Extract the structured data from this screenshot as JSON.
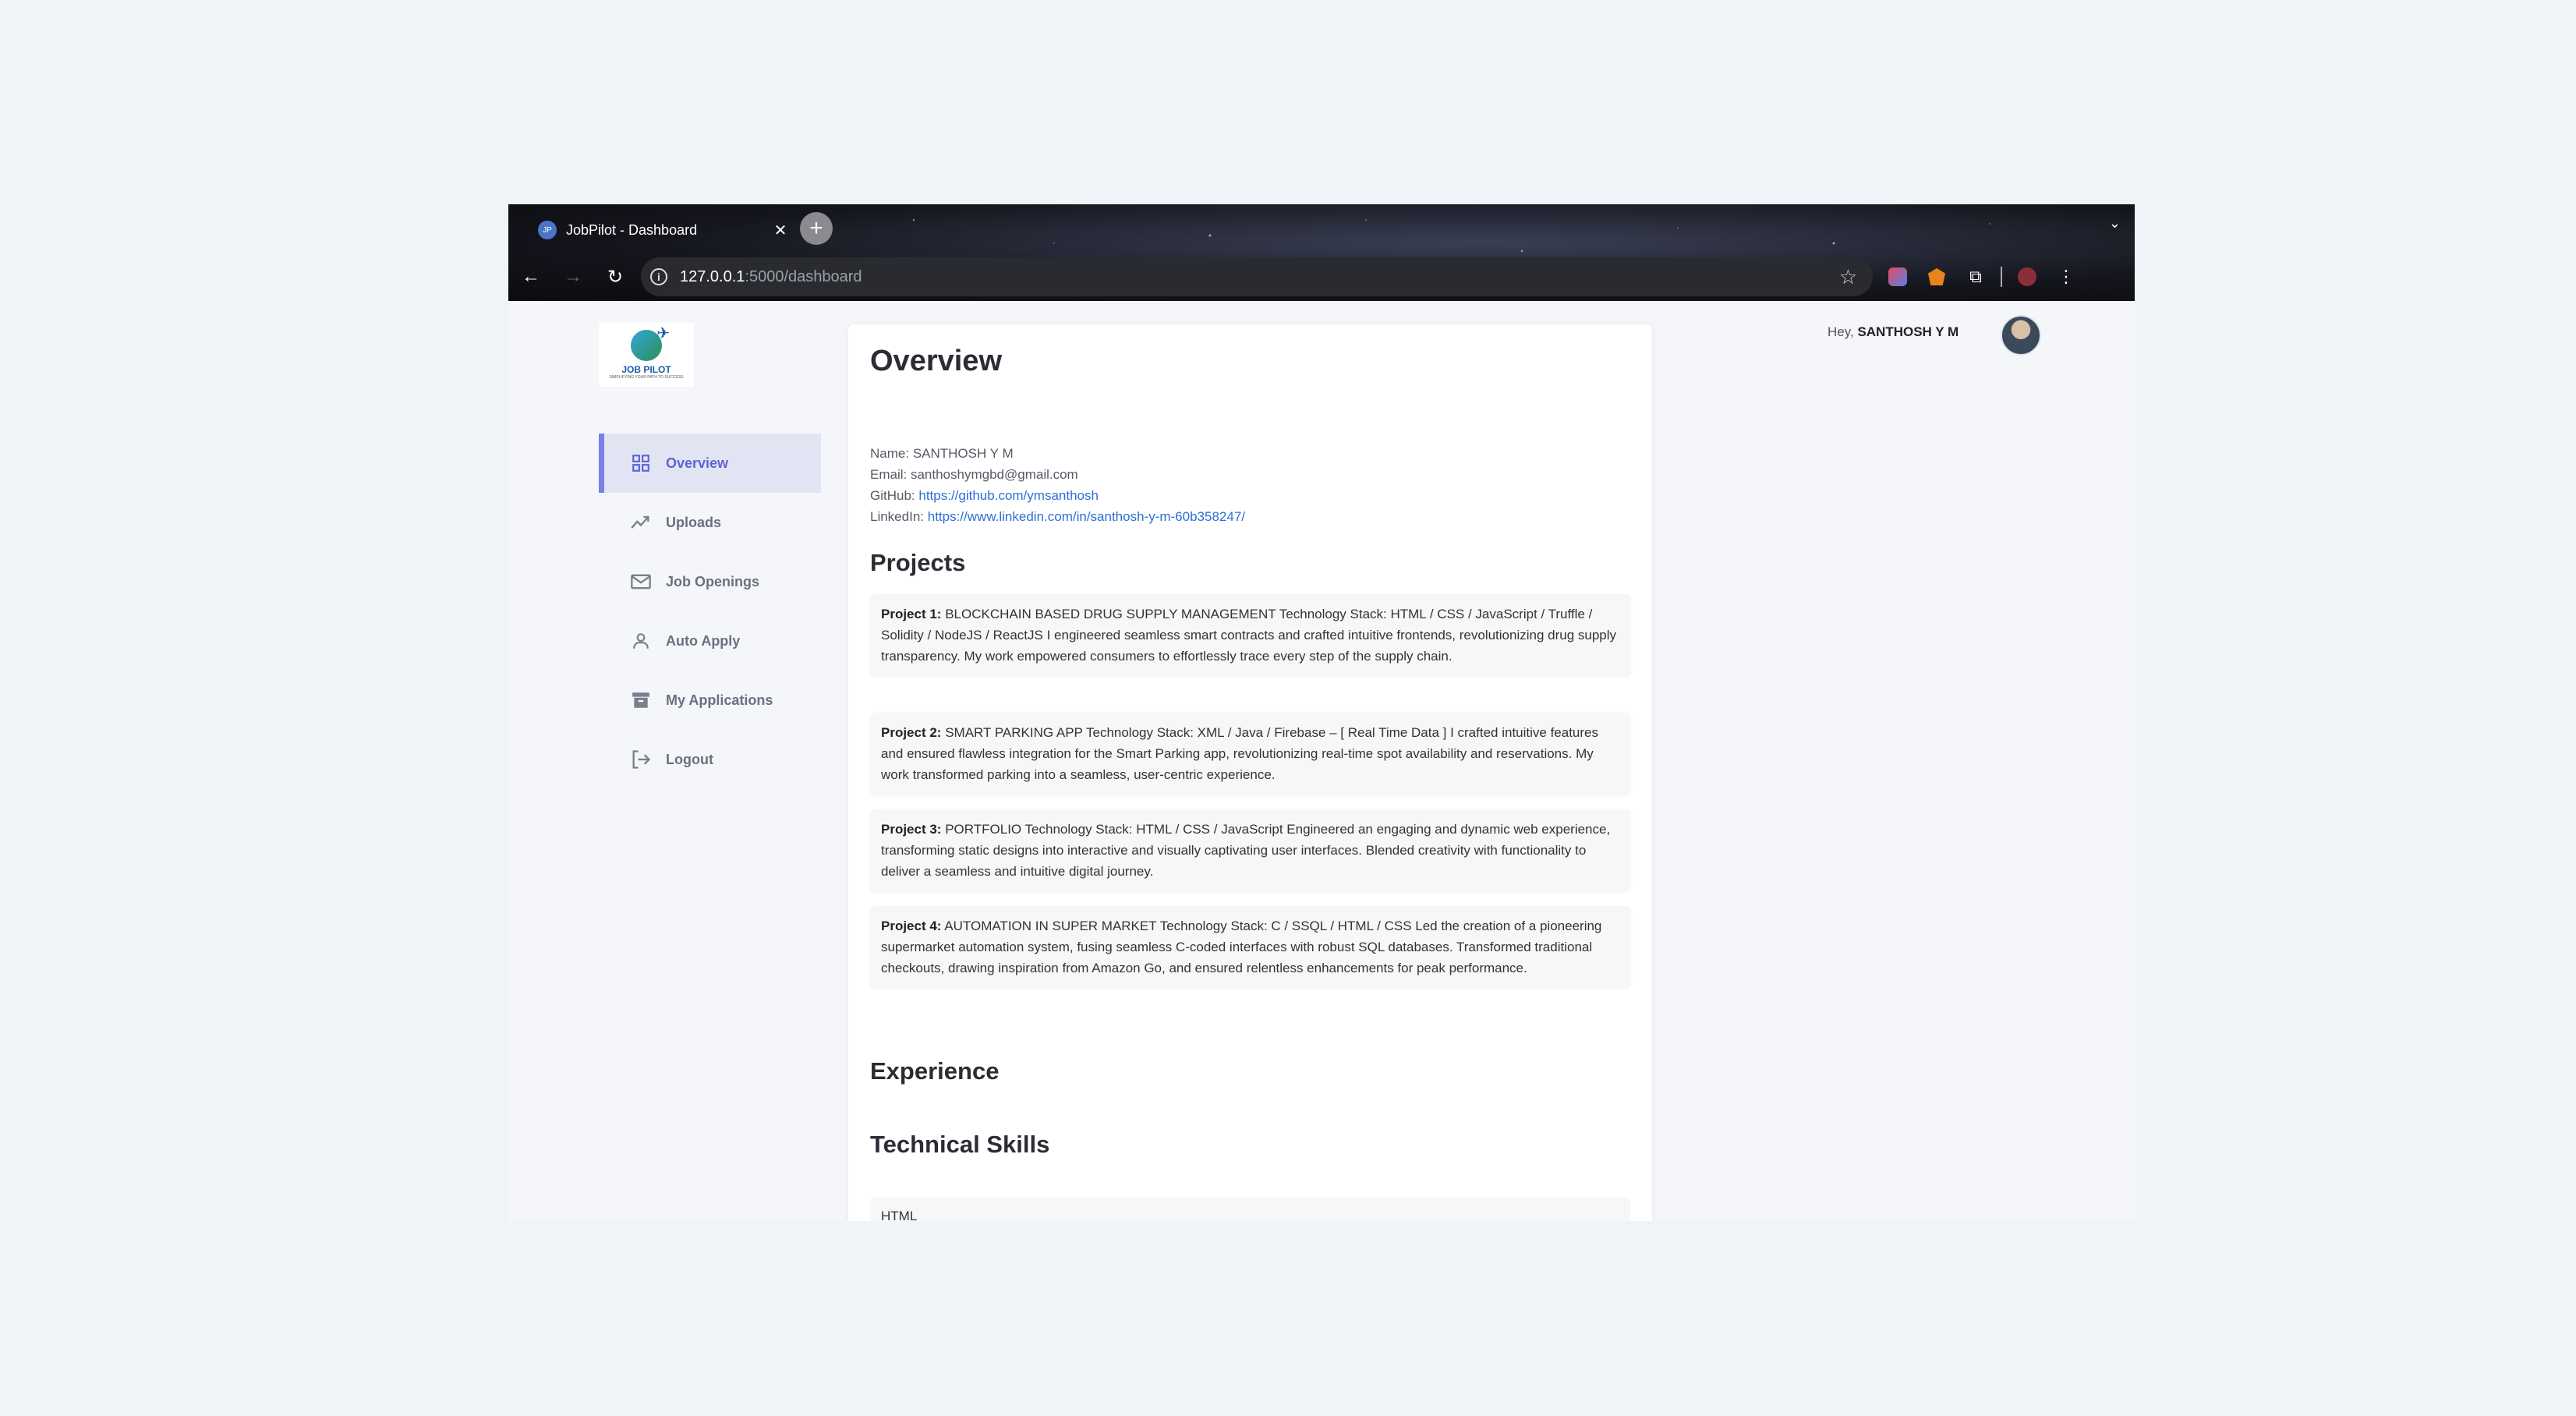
{
  "browser": {
    "tab_title": "JobPilot - Dashboard",
    "favicon_text": "JP",
    "url_host": "127.0.0.1",
    "url_path": ":5000/dashboard"
  },
  "sidebar": {
    "logo_text": "JOB PILOT",
    "logo_sub": "SIMPLIFYING YOUR PATH TO SUCCESS",
    "items": [
      {
        "label": "Overview",
        "icon": "grid-icon",
        "active": true
      },
      {
        "label": "Uploads",
        "icon": "trending-icon"
      },
      {
        "label": "Job Openings",
        "icon": "mail-icon"
      },
      {
        "label": "Auto Apply",
        "icon": "user-icon"
      },
      {
        "label": "My Applications",
        "icon": "archive-icon"
      },
      {
        "label": "Logout",
        "icon": "logout-icon"
      }
    ]
  },
  "header": {
    "greeting_prefix": "Hey,",
    "user_name": "SANTHOSH Y M"
  },
  "overview": {
    "title": "Overview",
    "name_label": "Name:",
    "name": "SANTHOSH Y M",
    "email_label": "Email:",
    "email": "santhoshymgbd@gmail.com",
    "github_label": "GitHub:",
    "github": "https://github.com/ymsanthosh",
    "linkedin_label": "LinkedIn:",
    "linkedin": "https://www.linkedin.com/in/santhosh-y-m-60b358247/",
    "projects_heading": "Projects",
    "projects": [
      {
        "label": "Project 1:",
        "text": "BLOCKCHAIN BASED DRUG SUPPLY MANAGEMENT Technology Stack: HTML / CSS / JavaScript / Truffle / Solidity / NodeJS / ReactJS I engineered seamless smart contracts and crafted intuitive frontends, revolutionizing drug supply transparency. My work empowered consumers to effortlessly trace every step of the supply chain."
      },
      {
        "label": "Project 2:",
        "text": "SMART PARKING APP Technology Stack: XML / Java / Firebase – [ Real Time Data ] I crafted intuitive features and ensured flawless integration for the Smart Parking app, revolutionizing real-time spot availability and reservations. My work transformed parking into a seamless, user-centric experience."
      },
      {
        "label": "Project 3:",
        "text": "PORTFOLIO Technology Stack: HTML / CSS / JavaScript Engineered an engaging and dynamic web experience, transforming static designs into interactive and visually captivating user interfaces. Blended creativity with functionality to deliver a seamless and intuitive digital journey."
      },
      {
        "label": "Project 4:",
        "text": "AUTOMATION IN SUPER MARKET Technology Stack: C / SSQL / HTML / CSS Led the creation of a pioneering supermarket automation system, fusing seamless C-coded interfaces with robust SQL databases. Transformed traditional checkouts, drawing inspiration from Amazon Go, and ensured relentless enhancements for peak performance."
      }
    ],
    "experience_heading": "Experience",
    "skills_heading": "Technical Skills",
    "skills": [
      "HTML"
    ]
  }
}
